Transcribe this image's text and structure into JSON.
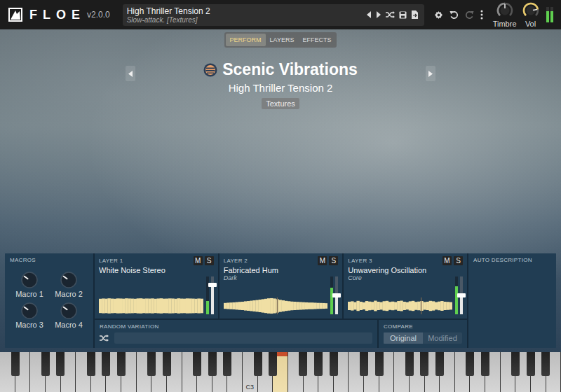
{
  "header": {
    "logo": "FLOE",
    "version": "v2.0.0",
    "preset": {
      "name": "High Thriller Tension 2",
      "description": "Slow-attack. [Textures]"
    },
    "redo_disabled": true,
    "knobs": [
      {
        "label": "Timbre",
        "level": 0.5,
        "color": "#8c8c8c"
      },
      {
        "label": "Vol",
        "level": 0.8,
        "color": "#e8c96a"
      }
    ],
    "meter": [
      0.75,
      0.75
    ]
  },
  "tabs": [
    {
      "label": "PERFORM",
      "selected": true
    },
    {
      "label": "LAYERS",
      "selected": false
    },
    {
      "label": "EFFECTS",
      "selected": false
    }
  ],
  "library": {
    "name": "Scenic Vibrations",
    "preset": "High Thriller Tension 2",
    "tags": [
      "Textures"
    ]
  },
  "macros": {
    "title": "MACROS",
    "knobs": [
      {
        "label": "Macro 1",
        "level": 0.3
      },
      {
        "label": "Macro 2",
        "level": 0.3
      },
      {
        "label": "Macro 3",
        "level": 0.3
      },
      {
        "label": "Macro 4",
        "level": 0.3
      }
    ]
  },
  "layers": [
    {
      "title": "LAYER 1",
      "name": "White Noise Stereo",
      "mute": "M",
      "solo": "S",
      "muted": false,
      "soloed": false,
      "meter": 0.35,
      "volume": 0.78,
      "waveform": [
        0.85,
        0.88,
        0.86,
        0.9,
        0.87,
        0.85,
        0.89,
        0.88,
        0.86,
        0.9,
        0.88,
        0.87,
        0.85,
        0.89,
        0.9,
        0.86,
        0.88,
        0.87,
        0.89,
        0.85,
        0.88,
        0.9,
        0.86,
        0.87,
        0.89,
        0.88,
        0.85,
        0.9,
        0.87,
        0.86,
        0.89,
        0.88,
        0.87,
        0.85,
        0.88,
        0.86
      ]
    },
    {
      "title": "LAYER 2",
      "name": "Fabricated Hum",
      "tag": "Dark",
      "mute": "M",
      "solo": "S",
      "muted": false,
      "soloed": false,
      "meter": 0.7,
      "volume": 0.5,
      "marker": 0.51,
      "waveform": [
        0.35,
        0.38,
        0.4,
        0.42,
        0.45,
        0.48,
        0.5,
        0.55,
        0.58,
        0.62,
        0.66,
        0.7,
        0.75,
        0.8,
        0.85,
        0.9,
        0.92,
        0.88,
        0.8,
        0.72,
        0.66,
        0.6,
        0.56,
        0.52,
        0.5,
        0.48,
        0.46,
        0.44,
        0.42,
        0.4,
        0.4,
        0.38,
        0.36,
        0.35,
        0.34,
        0.32
      ]
    },
    {
      "title": "LAYER 3",
      "name": "Unwavering Oscillation",
      "tag": "Core",
      "mute": "M",
      "solo": "S",
      "muted": false,
      "soloed": false,
      "meter": 0.75,
      "volume": 0.5,
      "marker": 0.7,
      "waveform": [
        0.5,
        0.55,
        0.45,
        0.6,
        0.5,
        0.42,
        0.58,
        0.52,
        0.48,
        0.62,
        0.5,
        0.45,
        0.56,
        0.6,
        0.48,
        0.52,
        0.46,
        0.58,
        0.62,
        0.5,
        0.44,
        0.55,
        0.6,
        0.48,
        0.52,
        0.58,
        0.46,
        0.5,
        0.6,
        0.55,
        0.45,
        0.52,
        0.58,
        0.5,
        0.48,
        0.45
      ]
    }
  ],
  "random_variation": {
    "title": "RANDOM VARIATION"
  },
  "compare": {
    "title": "COMPARE",
    "options": [
      {
        "label": "Original",
        "selected": true
      },
      {
        "label": "Modified",
        "selected": false
      }
    ]
  },
  "auto_description": {
    "title": "AUTO DESCRIPTION"
  },
  "keyboard": {
    "keys": [
      {
        "pressed": false
      },
      {
        "pressed": false
      },
      {
        "pressed": false
      },
      {
        "pressed": false
      },
      {
        "pressed": false
      },
      {
        "pressed": false
      },
      {
        "pressed": false
      },
      {
        "pressed": false
      },
      {
        "pressed": false
      },
      {
        "pressed": false
      },
      {
        "pressed": false
      },
      {
        "pressed": false
      },
      {
        "pressed": false
      },
      {
        "pressed": false
      },
      {
        "pressed": false
      },
      {
        "pressed": false
      },
      {
        "pressed": false,
        "label": "C3"
      },
      {
        "pressed": false
      },
      {
        "pressed": true
      },
      {
        "pressed": false
      },
      {
        "pressed": false
      },
      {
        "pressed": false
      },
      {
        "pressed": false
      },
      {
        "pressed": false
      },
      {
        "pressed": false
      },
      {
        "pressed": false
      },
      {
        "pressed": false
      },
      {
        "pressed": false
      },
      {
        "pressed": false
      },
      {
        "pressed": false
      },
      {
        "pressed": false
      },
      {
        "pressed": false
      },
      {
        "pressed": false
      },
      {
        "pressed": false
      },
      {
        "pressed": false
      },
      {
        "pressed": false
      },
      {
        "pressed": false
      }
    ]
  }
}
